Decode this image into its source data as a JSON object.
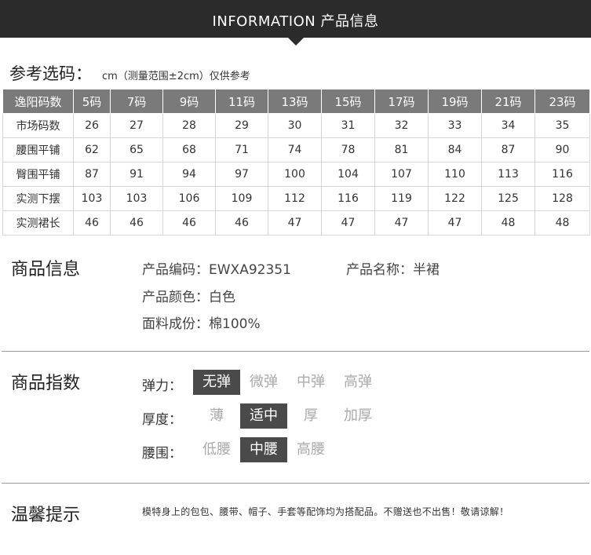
{
  "header": {
    "title": "INFORMATION 产品信息"
  },
  "size_chart": {
    "heading": "参考选码：",
    "note": "cm（测量范围±2cm）仅供参考",
    "columns": [
      "逸阳码数",
      "5码",
      "7码",
      "9码",
      "11码",
      "13码",
      "15码",
      "17码",
      "19码",
      "21码",
      "23码"
    ],
    "rows": [
      {
        "label": "市场码数",
        "values": [
          "26",
          "27",
          "28",
          "29",
          "30",
          "31",
          "32",
          "33",
          "34",
          "35"
        ]
      },
      {
        "label": "腰围平铺",
        "values": [
          "62",
          "65",
          "68",
          "71",
          "74",
          "78",
          "81",
          "84",
          "87",
          "90"
        ]
      },
      {
        "label": "臀围平铺",
        "values": [
          "87",
          "91",
          "94",
          "97",
          "100",
          "104",
          "107",
          "110",
          "113",
          "116"
        ]
      },
      {
        "label": "实测下摆",
        "values": [
          "103",
          "103",
          "106",
          "109",
          "112",
          "116",
          "119",
          "122",
          "125",
          "128"
        ]
      },
      {
        "label": "实测裙长",
        "values": [
          "46",
          "46",
          "46",
          "46",
          "47",
          "47",
          "47",
          "47",
          "48",
          "48"
        ]
      }
    ]
  },
  "product_info": {
    "title": "商品信息",
    "code": "产品编码：EWXA92351",
    "name": "产品名称：半裙",
    "color": "产品颜色：白色",
    "fabric": "面料成份：棉100%"
  },
  "product_index": {
    "title": "商品指数",
    "elasticity": {
      "label": "弹力：",
      "options": [
        "无弹",
        "微弹",
        "中弹",
        "高弹"
      ],
      "selected": "无弹"
    },
    "thickness": {
      "label": "厚度：",
      "options": [
        "薄",
        "适中",
        "厚",
        "加厚"
      ],
      "selected": "适中"
    },
    "waist": {
      "label": "腰围：",
      "options": [
        "低腰",
        "中腰",
        "高腰"
      ],
      "selected": "中腰"
    },
    "colors": {
      "selected_bg": "#4a4a4a",
      "unselected_text": "#aaaaaa"
    }
  },
  "tips": {
    "title": "温馨提示",
    "text": "模特身上的包包、腰带、帽子、手套等配饰均为搭配品。不赠送也不出售！敬请谅解！"
  }
}
